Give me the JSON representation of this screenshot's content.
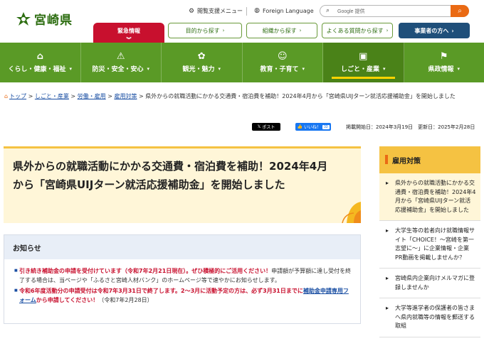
{
  "header": {
    "logo_text": "宮崎県",
    "util_support": "閲覧支援メニュー",
    "util_lang": "Foreign Language",
    "search_placeholder": "Google 提供",
    "emergency_label": "緊急情報",
    "pills": [
      "目的から探す",
      "組織から探す",
      "よくある質問から探す"
    ],
    "biz_label": "事業者の方へ",
    "accent": "#5a9a26",
    "emergency_color": "#c8102e"
  },
  "gnav": [
    {
      "icon": "house-icon",
      "glyph": "⌂",
      "label": "くらし・健康・福祉"
    },
    {
      "icon": "fire-icon",
      "glyph": "⚠",
      "label": "防災・安全・安心"
    },
    {
      "icon": "palm-icon",
      "glyph": "✿",
      "label": "観光・魅力"
    },
    {
      "icon": "stroller-icon",
      "glyph": "☺",
      "label": "教育・子育て"
    },
    {
      "icon": "briefcase-icon",
      "glyph": "▣",
      "label": "しごと・産業"
    },
    {
      "icon": "flag-icon",
      "glyph": "⚑",
      "label": "県政情報"
    }
  ],
  "breadcrumb": {
    "links": [
      "トップ",
      "しごと・産業",
      "労働・雇用",
      "雇用対策"
    ],
    "current": "県外からの就職活動にかかる交通費・宿泊費を補助！2024年4月から「宮崎県UIJターン就活応援補助金」を開始しました"
  },
  "share": {
    "x_label": "ポスト",
    "fb_label": "いいね！",
    "fb_count": "33",
    "dates": "掲載開始日：2024年3月19日　更新日：2025年2月28日"
  },
  "article": {
    "title": "県外からの就職活動にかかる交通費・宿泊費を補助！2024年4月から「宮崎県UIJターン就活応援補助金」を開始しました"
  },
  "notice": {
    "heading": "お知らせ",
    "item1_red": "引き続き補助金の申請を受付けています（令和7年2月21日現在）。ぜひ積極的にご活用ください！",
    "item1_rest": "申請額が予算額に達し受付を終了する場合は、当ページや「ふるさと宮崎人材バンク」のホームページ等で速やかにお知らせします。",
    "item2_red_a": "令和6年度活動分の申請受付は令和7年3月31日で終了します。2～3月に活動予定の方は、必ず3月31日までに",
    "item2_link": "補助金申請専用フォーム",
    "item2_red_b": "から申請してください！",
    "item2_rest": "（令和7年2月28日）"
  },
  "sidebar": {
    "heading": "雇用対策",
    "items": [
      "県外からの就職活動にかかる交通費・宿泊費を補助！2024年4月から「宮崎県UIJターン就活応援補助金」を開始しました",
      "大学生等の若者向け就職情報サイト「CHOICE！～宮崎を第一志望に～」に企業情報・企業PR動画を掲載しませんか？",
      "宮崎県内企業向けメルマガに登録しませんか",
      "大学等進学者の保護者の皆さまへ県内就職等の情報を郵送する取組"
    ]
  }
}
